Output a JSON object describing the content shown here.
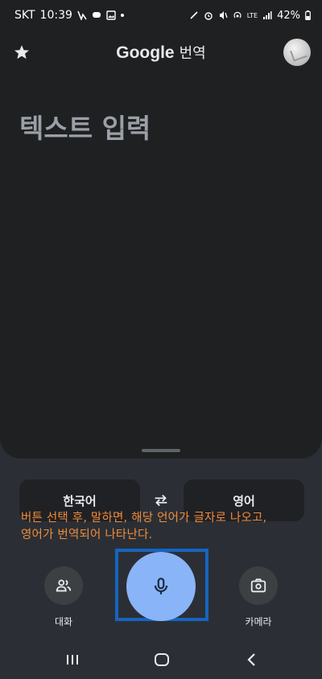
{
  "status_bar": {
    "carrier": "SKT",
    "time": "10:39",
    "network": "LTE",
    "battery": "42%"
  },
  "header": {
    "title_brand": "Google",
    "title_suffix": "번역",
    "favorite_icon": "star-icon",
    "account_icon": "avatar"
  },
  "input": {
    "placeholder": "텍스트 입력"
  },
  "languages": {
    "source": "한국어",
    "target": "영어",
    "swap_icon": "swap-arrows-icon"
  },
  "annotation": {
    "line1": "버튼 선택 후, 말하면, 해당 언어가 글자로 나오고,",
    "line2": "영어가 번역되어 나타난다."
  },
  "controls": {
    "conversation_label": "대화",
    "camera_label": "카메라",
    "mic_icon": "mic-icon"
  },
  "colors": {
    "accent_mic": "#8ab4f8",
    "annotation": "#f28b3a",
    "highlight_frame": "#1565c0"
  }
}
